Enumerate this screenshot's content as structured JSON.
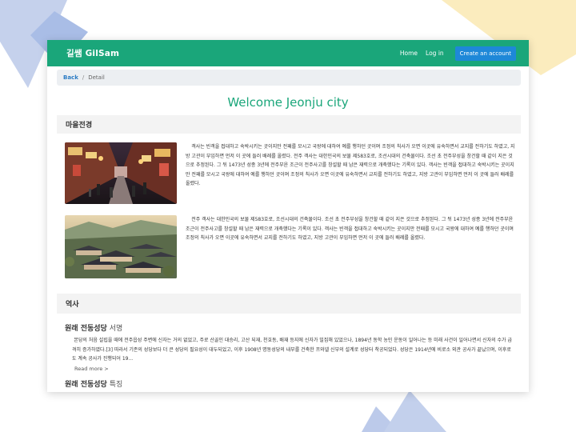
{
  "navbar": {
    "brand": "길쌤 GilSam",
    "home_label": "Home",
    "login_label": "Log in",
    "create_account_label": "Create an account"
  },
  "breadcrumb": {
    "back_label": "Back",
    "separator": "/",
    "current": "Detail"
  },
  "page_title": "Welcome Jeonju city",
  "section_village": {
    "heading": "마을전경",
    "items": [
      {
        "image_icon": "market-street-photo",
        "text": "객사는 빈객을 접대하고 숙박시키는 곳이지만 전패를 모시고 국왕에 대하여 예를 행하던 곳이며 조정의 칙사가 오면 이곳에 유숙하면서 교지를 전하기도 하였고, 지방 고관이 부임하면 먼저 이 곳에 들러 배례를 올렸다. 전주 객사는 대한민국의 보물 제583호로, 조선시대의 건축물이다. 조선 초 전주부성을 창건할 때 같이 지은 것으로 추정된다. 그 뒤 1473년 성종 3년에 전주부윤 조근이 전주사고를 창설할 때 남은 재력으로 개축했다는 기록이 있다. 객사는 빈객을 접대하고 숙박시키는 곳이지만 전패를 모시고 국왕에 대하여 예를 행하던 곳이며 조정의 칙사가 오면 이곳에 유숙하면서 교지를 전하기도 하였고, 지방 고관이 부임하면 먼저 이 곳에 들러 배례를 올렸다."
      },
      {
        "image_icon": "hanok-village-photo",
        "text": "전주 객사는 대한민국의 보물 제583호로, 조선시대의 건축물이다. 조선 초 전주부성을 창건할 때 같이 지은 것으로 추정된다. 그 뒤 1473년 성종 3년에 전주부윤 조근이 전주사고를 창설할 때 남은 재력으로 개축했다는 기록이 있다. 객사는 빈객을 접대하고 숙박시키는 곳이지만 전패를 모시고 국왕에 대하여 예를 행하던 곳이며 조정의 칙사가 오면 이곳에 유숙하면서 교지를 전하기도 하였고, 지방 고관이 부임하면 먼저 이 곳에 들러 배례를 올렸다."
      }
    ]
  },
  "section_history": {
    "heading": "역사",
    "article1": {
      "title_bold": "원래 전동성당",
      "title_light": "서명",
      "text": "본당의 처음 설립을 때에 전주읍성 주변에 신자는 거의 없었고, 주로 산골인 대승리, 고산 되재, 천호동, 배재 등지에 신자가 밀집해 있었으나, 1894년 동학 농민 운동이 일어나는 등 미래 사건이 일어나면서 신자의 수가 급격히 증가하였다.[3] 따라서 기존의 성당보다 더 큰 성당의 필요성이 대두되었고, 이후 1908년 명동성당의 내부를 건축한 프와넬 신부의 설계로 성당터 착공되었다. 성당은 1914년에 비로소 외관 공사가 끝났으며, 이후로도 계속 공사가 진행되어 19...",
      "read_more": "Read more >"
    },
    "article2": {
      "title_bold": "원래 전동성당",
      "title_light": "특징"
    }
  },
  "colors": {
    "navbar": "#1aa67a",
    "title": "#1aa67a",
    "button": "#1e88d8",
    "link": "#2c7cc4",
    "deco_blue": "#b8c8e8",
    "deco_yellow": "#faeab8"
  }
}
